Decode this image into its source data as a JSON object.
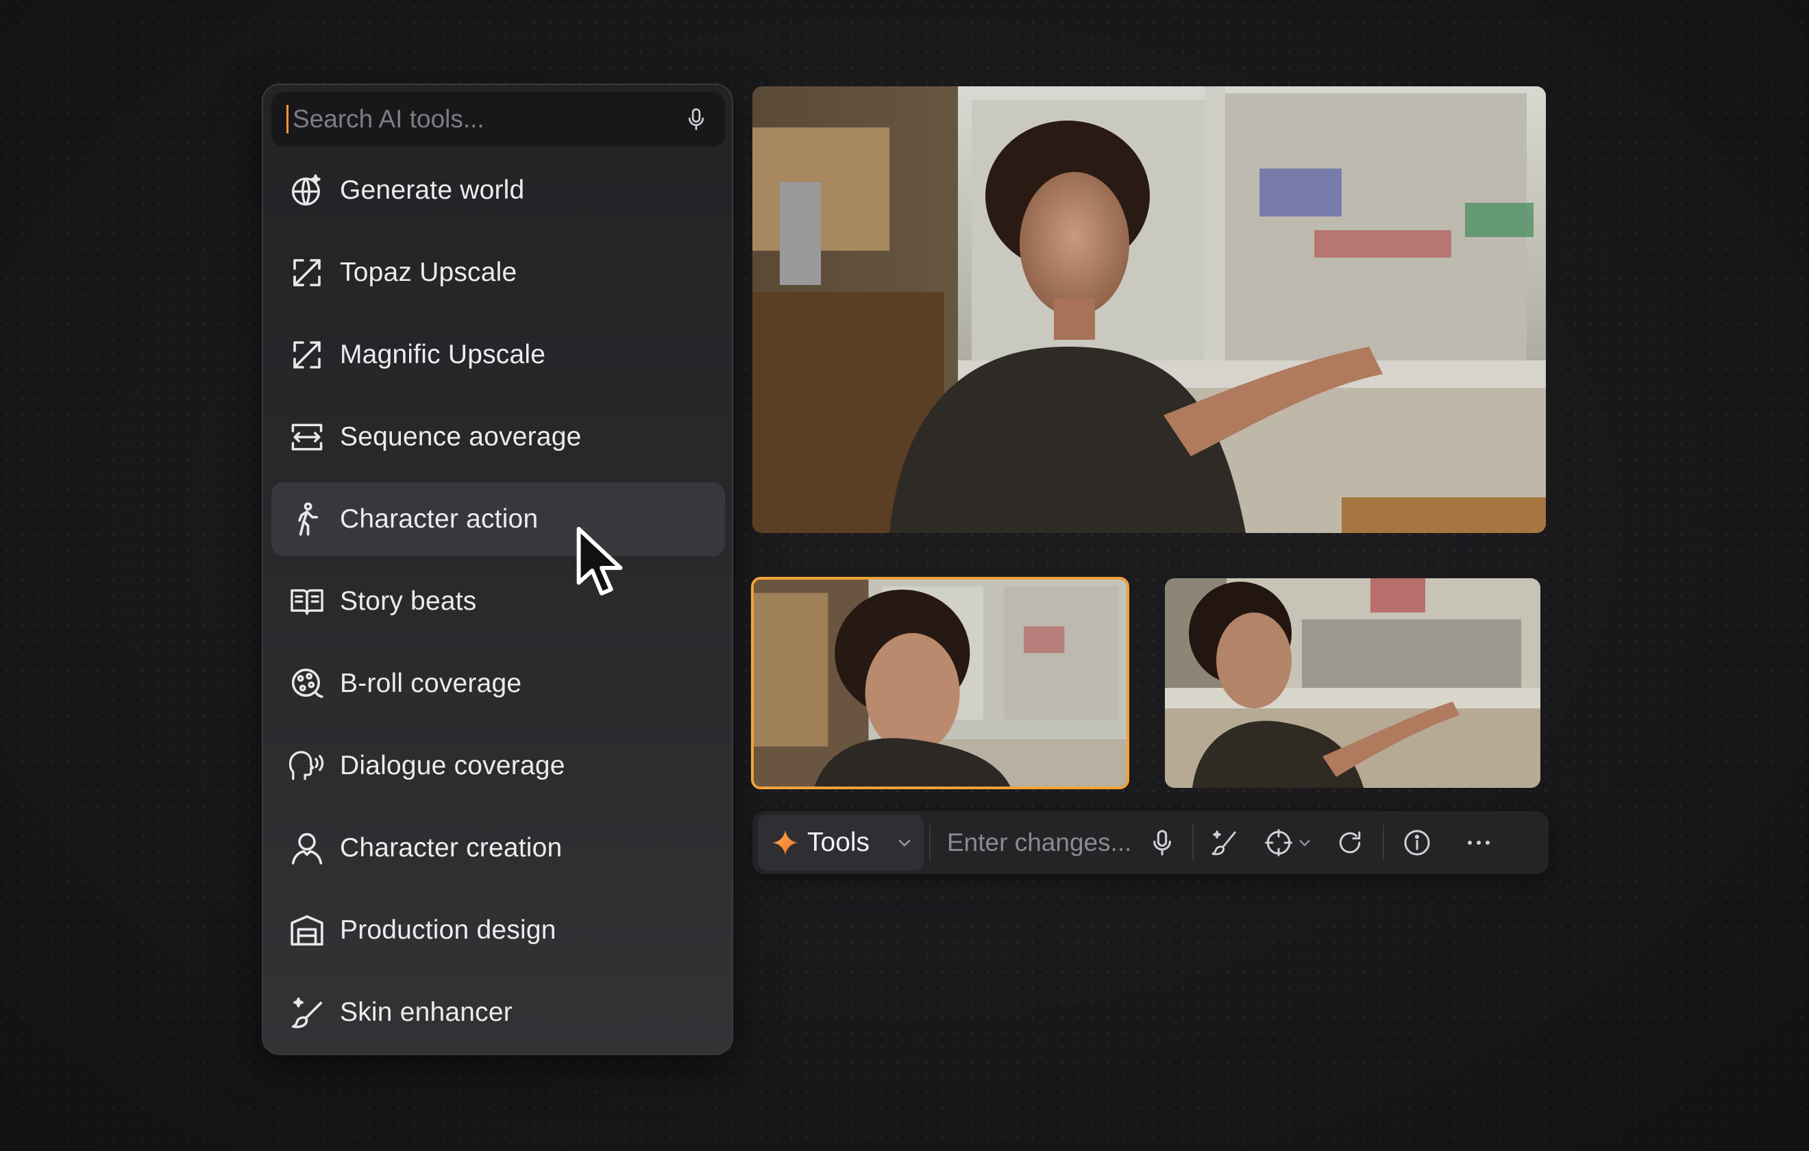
{
  "search": {
    "placeholder": "Search AI tools..."
  },
  "tools": [
    {
      "label": "Generate world",
      "icon": "globe-sparkle-icon",
      "active": false
    },
    {
      "label": "Topaz Upscale",
      "icon": "expand-arrows-icon",
      "active": false
    },
    {
      "label": "Magnific Upscale",
      "icon": "expand-arrows-icon",
      "active": false
    },
    {
      "label": "Sequence aoverage",
      "icon": "sequence-frame-icon",
      "active": false
    },
    {
      "label": "Character action",
      "icon": "walking-figure-icon",
      "active": true
    },
    {
      "label": "Story beats",
      "icon": "open-book-icon",
      "active": false
    },
    {
      "label": "B-roll coverage",
      "icon": "film-reel-icon",
      "active": false
    },
    {
      "label": "Dialogue coverage",
      "icon": "speaking-head-icon",
      "active": false
    },
    {
      "label": "Character creation",
      "icon": "person-outline-icon",
      "active": false
    },
    {
      "label": "Production design",
      "icon": "set-frame-icon",
      "active": false
    },
    {
      "label": "Skin enhancer",
      "icon": "brush-sparkle-icon",
      "active": false
    }
  ],
  "toolbar": {
    "tools_label": "Tools",
    "changes_placeholder": "Enter changes...",
    "buttons": [
      "mic-icon",
      "brush-sparkle-icon",
      "target-icon",
      "refresh-icon",
      "info-icon",
      "more-icon"
    ]
  },
  "colors": {
    "accent": "#f2a33a",
    "background": "#1b1b1e",
    "panel": "#2a2a2d",
    "active_item": "#38383c"
  }
}
